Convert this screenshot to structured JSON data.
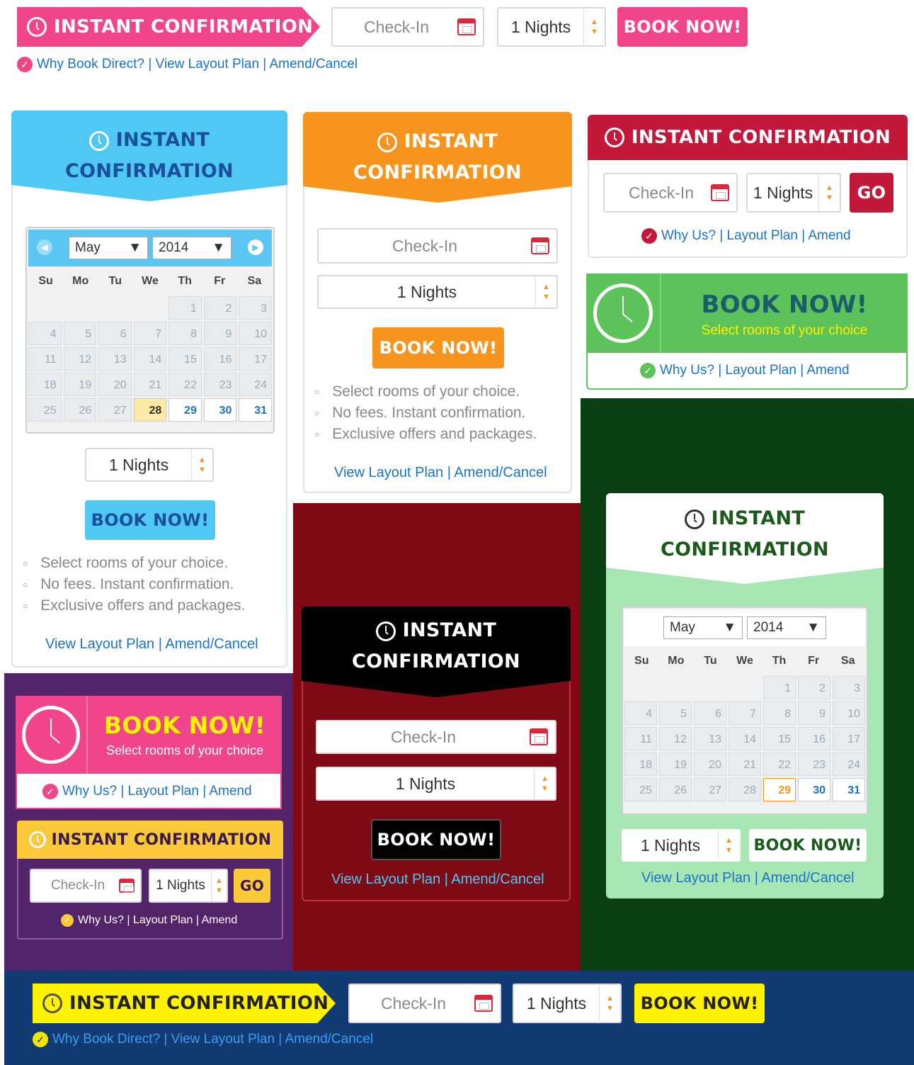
{
  "common": {
    "checkin_placeholder": "Check-In",
    "nights": "1 Nights",
    "book_now": "BOOK NOW!",
    "go": "GO",
    "instant": "INSTANT",
    "confirmation": "CONFIRMATION",
    "instant_confirmation": "INSTANT CONFIRMATION",
    "select_rooms": "Select rooms of your choice",
    "links_short": "Why Us? | Layout Plan | Amend",
    "links_long": "Why Book Direct? | View Layout Plan | Amend/Cancel",
    "links_layout": "View Layout Plan | Amend/Cancel",
    "features": [
      "Select rooms of your choice.",
      "No fees. Instant confirmation.",
      "Exclusive offers and packages."
    ]
  },
  "calendar": {
    "month": "May",
    "year": "2014",
    "weekdays": [
      "Su",
      "Mo",
      "Tu",
      "We",
      "Th",
      "Fr",
      "Sa"
    ],
    "leading_blanks": 4,
    "days_in_month": 31,
    "today": 28,
    "today_green": 29,
    "first_available_blue": 28,
    "first_available_green": 29
  },
  "colors": {
    "pink": "#f0458a",
    "sky": "#4fc8f4",
    "orange": "#f7941d",
    "crimson": "#c2183a",
    "green": "#5cc35a",
    "purple": "#54246a",
    "maroon": "#7f0a15",
    "darkgreen": "#0b3f14",
    "navy": "#123a73",
    "yellow": "#fff200",
    "gold": "#f9c93a",
    "mint": "#a8e6b4"
  }
}
